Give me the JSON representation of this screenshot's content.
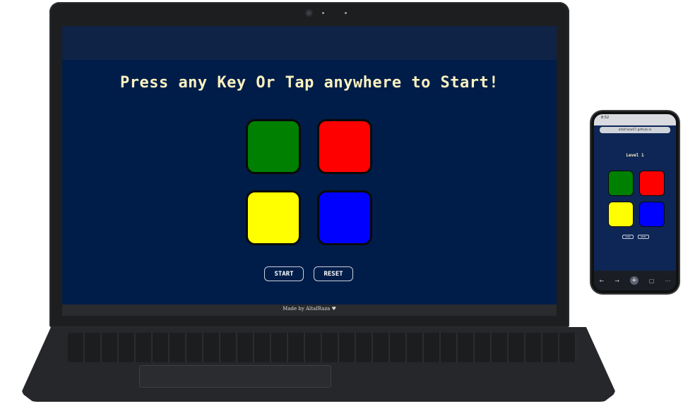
{
  "laptop": {
    "headline": "Press any Key Or Tap anywhere to Start!",
    "buttons": {
      "start": "START",
      "reset": "RESET"
    },
    "footer": "Made by AltafRaza ♥"
  },
  "pads": [
    "green",
    "red",
    "yellow",
    "blue"
  ],
  "colors": {
    "background": "#001d49",
    "headline": "#fbf2c0",
    "green": "#008000",
    "red": "#ff0000",
    "yellow": "#ffff00",
    "blue": "#0000ff"
  },
  "phone": {
    "time": "8:52",
    "url": "altafraza07.github.io",
    "level": "Level 1",
    "buttons": {
      "start": "START",
      "reset": "RESET"
    },
    "nav_icons": [
      "back-icon",
      "forward-icon",
      "new-tab-icon",
      "tabs-icon",
      "more-icon"
    ]
  }
}
